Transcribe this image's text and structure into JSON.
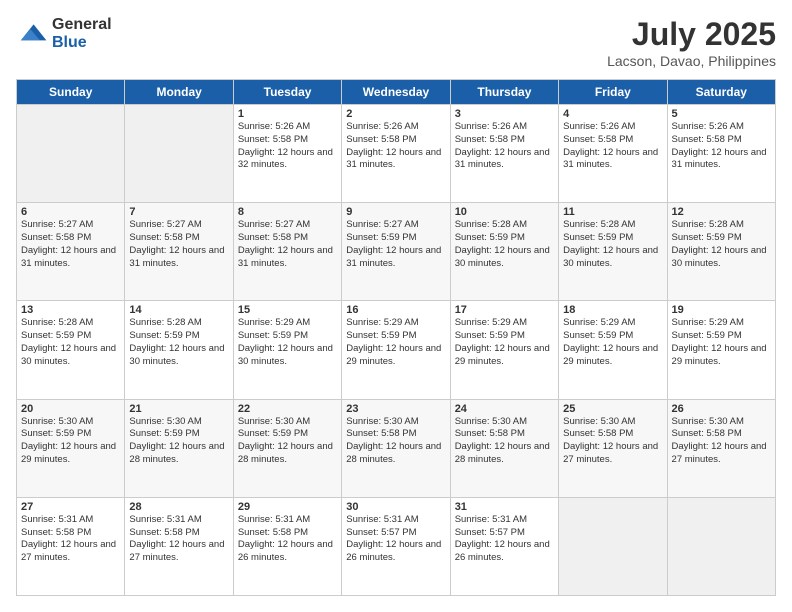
{
  "logo": {
    "general": "General",
    "blue": "Blue"
  },
  "header": {
    "month_year": "July 2025",
    "location": "Lacson, Davao, Philippines"
  },
  "days_of_week": [
    "Sunday",
    "Monday",
    "Tuesday",
    "Wednesday",
    "Thursday",
    "Friday",
    "Saturday"
  ],
  "weeks": [
    [
      {
        "day": "",
        "empty": true
      },
      {
        "day": "",
        "empty": true
      },
      {
        "day": "1",
        "sunrise": "Sunrise: 5:26 AM",
        "sunset": "Sunset: 5:58 PM",
        "daylight": "Daylight: 12 hours and 32 minutes."
      },
      {
        "day": "2",
        "sunrise": "Sunrise: 5:26 AM",
        "sunset": "Sunset: 5:58 PM",
        "daylight": "Daylight: 12 hours and 31 minutes."
      },
      {
        "day": "3",
        "sunrise": "Sunrise: 5:26 AM",
        "sunset": "Sunset: 5:58 PM",
        "daylight": "Daylight: 12 hours and 31 minutes."
      },
      {
        "day": "4",
        "sunrise": "Sunrise: 5:26 AM",
        "sunset": "Sunset: 5:58 PM",
        "daylight": "Daylight: 12 hours and 31 minutes."
      },
      {
        "day": "5",
        "sunrise": "Sunrise: 5:26 AM",
        "sunset": "Sunset: 5:58 PM",
        "daylight": "Daylight: 12 hours and 31 minutes."
      }
    ],
    [
      {
        "day": "6",
        "sunrise": "Sunrise: 5:27 AM",
        "sunset": "Sunset: 5:58 PM",
        "daylight": "Daylight: 12 hours and 31 minutes."
      },
      {
        "day": "7",
        "sunrise": "Sunrise: 5:27 AM",
        "sunset": "Sunset: 5:58 PM",
        "daylight": "Daylight: 12 hours and 31 minutes."
      },
      {
        "day": "8",
        "sunrise": "Sunrise: 5:27 AM",
        "sunset": "Sunset: 5:58 PM",
        "daylight": "Daylight: 12 hours and 31 minutes."
      },
      {
        "day": "9",
        "sunrise": "Sunrise: 5:27 AM",
        "sunset": "Sunset: 5:59 PM",
        "daylight": "Daylight: 12 hours and 31 minutes."
      },
      {
        "day": "10",
        "sunrise": "Sunrise: 5:28 AM",
        "sunset": "Sunset: 5:59 PM",
        "daylight": "Daylight: 12 hours and 30 minutes."
      },
      {
        "day": "11",
        "sunrise": "Sunrise: 5:28 AM",
        "sunset": "Sunset: 5:59 PM",
        "daylight": "Daylight: 12 hours and 30 minutes."
      },
      {
        "day": "12",
        "sunrise": "Sunrise: 5:28 AM",
        "sunset": "Sunset: 5:59 PM",
        "daylight": "Daylight: 12 hours and 30 minutes."
      }
    ],
    [
      {
        "day": "13",
        "sunrise": "Sunrise: 5:28 AM",
        "sunset": "Sunset: 5:59 PM",
        "daylight": "Daylight: 12 hours and 30 minutes."
      },
      {
        "day": "14",
        "sunrise": "Sunrise: 5:28 AM",
        "sunset": "Sunset: 5:59 PM",
        "daylight": "Daylight: 12 hours and 30 minutes."
      },
      {
        "day": "15",
        "sunrise": "Sunrise: 5:29 AM",
        "sunset": "Sunset: 5:59 PM",
        "daylight": "Daylight: 12 hours and 30 minutes."
      },
      {
        "day": "16",
        "sunrise": "Sunrise: 5:29 AM",
        "sunset": "Sunset: 5:59 PM",
        "daylight": "Daylight: 12 hours and 29 minutes."
      },
      {
        "day": "17",
        "sunrise": "Sunrise: 5:29 AM",
        "sunset": "Sunset: 5:59 PM",
        "daylight": "Daylight: 12 hours and 29 minutes."
      },
      {
        "day": "18",
        "sunrise": "Sunrise: 5:29 AM",
        "sunset": "Sunset: 5:59 PM",
        "daylight": "Daylight: 12 hours and 29 minutes."
      },
      {
        "day": "19",
        "sunrise": "Sunrise: 5:29 AM",
        "sunset": "Sunset: 5:59 PM",
        "daylight": "Daylight: 12 hours and 29 minutes."
      }
    ],
    [
      {
        "day": "20",
        "sunrise": "Sunrise: 5:30 AM",
        "sunset": "Sunset: 5:59 PM",
        "daylight": "Daylight: 12 hours and 29 minutes."
      },
      {
        "day": "21",
        "sunrise": "Sunrise: 5:30 AM",
        "sunset": "Sunset: 5:59 PM",
        "daylight": "Daylight: 12 hours and 28 minutes."
      },
      {
        "day": "22",
        "sunrise": "Sunrise: 5:30 AM",
        "sunset": "Sunset: 5:59 PM",
        "daylight": "Daylight: 12 hours and 28 minutes."
      },
      {
        "day": "23",
        "sunrise": "Sunrise: 5:30 AM",
        "sunset": "Sunset: 5:58 PM",
        "daylight": "Daylight: 12 hours and 28 minutes."
      },
      {
        "day": "24",
        "sunrise": "Sunrise: 5:30 AM",
        "sunset": "Sunset: 5:58 PM",
        "daylight": "Daylight: 12 hours and 28 minutes."
      },
      {
        "day": "25",
        "sunrise": "Sunrise: 5:30 AM",
        "sunset": "Sunset: 5:58 PM",
        "daylight": "Daylight: 12 hours and 27 minutes."
      },
      {
        "day": "26",
        "sunrise": "Sunrise: 5:30 AM",
        "sunset": "Sunset: 5:58 PM",
        "daylight": "Daylight: 12 hours and 27 minutes."
      }
    ],
    [
      {
        "day": "27",
        "sunrise": "Sunrise: 5:31 AM",
        "sunset": "Sunset: 5:58 PM",
        "daylight": "Daylight: 12 hours and 27 minutes."
      },
      {
        "day": "28",
        "sunrise": "Sunrise: 5:31 AM",
        "sunset": "Sunset: 5:58 PM",
        "daylight": "Daylight: 12 hours and 27 minutes."
      },
      {
        "day": "29",
        "sunrise": "Sunrise: 5:31 AM",
        "sunset": "Sunset: 5:58 PM",
        "daylight": "Daylight: 12 hours and 26 minutes."
      },
      {
        "day": "30",
        "sunrise": "Sunrise: 5:31 AM",
        "sunset": "Sunset: 5:57 PM",
        "daylight": "Daylight: 12 hours and 26 minutes."
      },
      {
        "day": "31",
        "sunrise": "Sunrise: 5:31 AM",
        "sunset": "Sunset: 5:57 PM",
        "daylight": "Daylight: 12 hours and 26 minutes."
      },
      {
        "day": "",
        "empty": true
      },
      {
        "day": "",
        "empty": true
      }
    ]
  ]
}
